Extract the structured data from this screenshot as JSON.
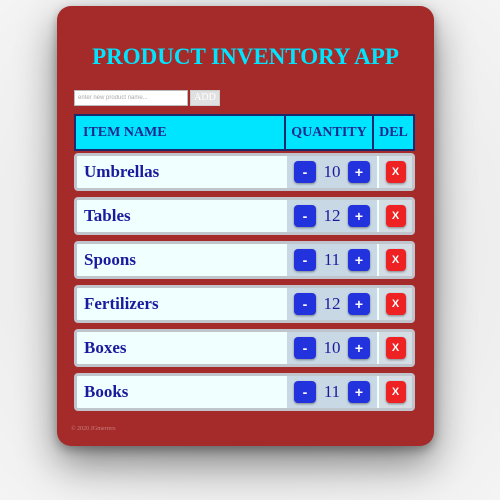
{
  "app": {
    "title": "PRODUCT INVENTORY APP",
    "footer": "© 2020 JGmerrers"
  },
  "add_form": {
    "placeholder": "enter new product name...",
    "button_label": "ADD"
  },
  "table": {
    "headers": {
      "name": "ITEM NAME",
      "quantity": "QUANTITY",
      "del": "DEL"
    },
    "rows": [
      {
        "name": "Umbrellas",
        "quantity": "10"
      },
      {
        "name": "Tables",
        "quantity": "12"
      },
      {
        "name": "Spoons",
        "quantity": "11"
      },
      {
        "name": "Fertilizers",
        "quantity": "12"
      },
      {
        "name": "Boxes",
        "quantity": "10"
      },
      {
        "name": "Books",
        "quantity": "11"
      }
    ],
    "minus_label": "-",
    "plus_label": "+",
    "del_label": "X"
  },
  "colors": {
    "card": "#a52a2a",
    "title": "#00e5ff",
    "header_bg": "#00e5ff",
    "row_text": "#1a1a9e",
    "qty_button": "#2233dd",
    "del_button": "#ee2222"
  }
}
